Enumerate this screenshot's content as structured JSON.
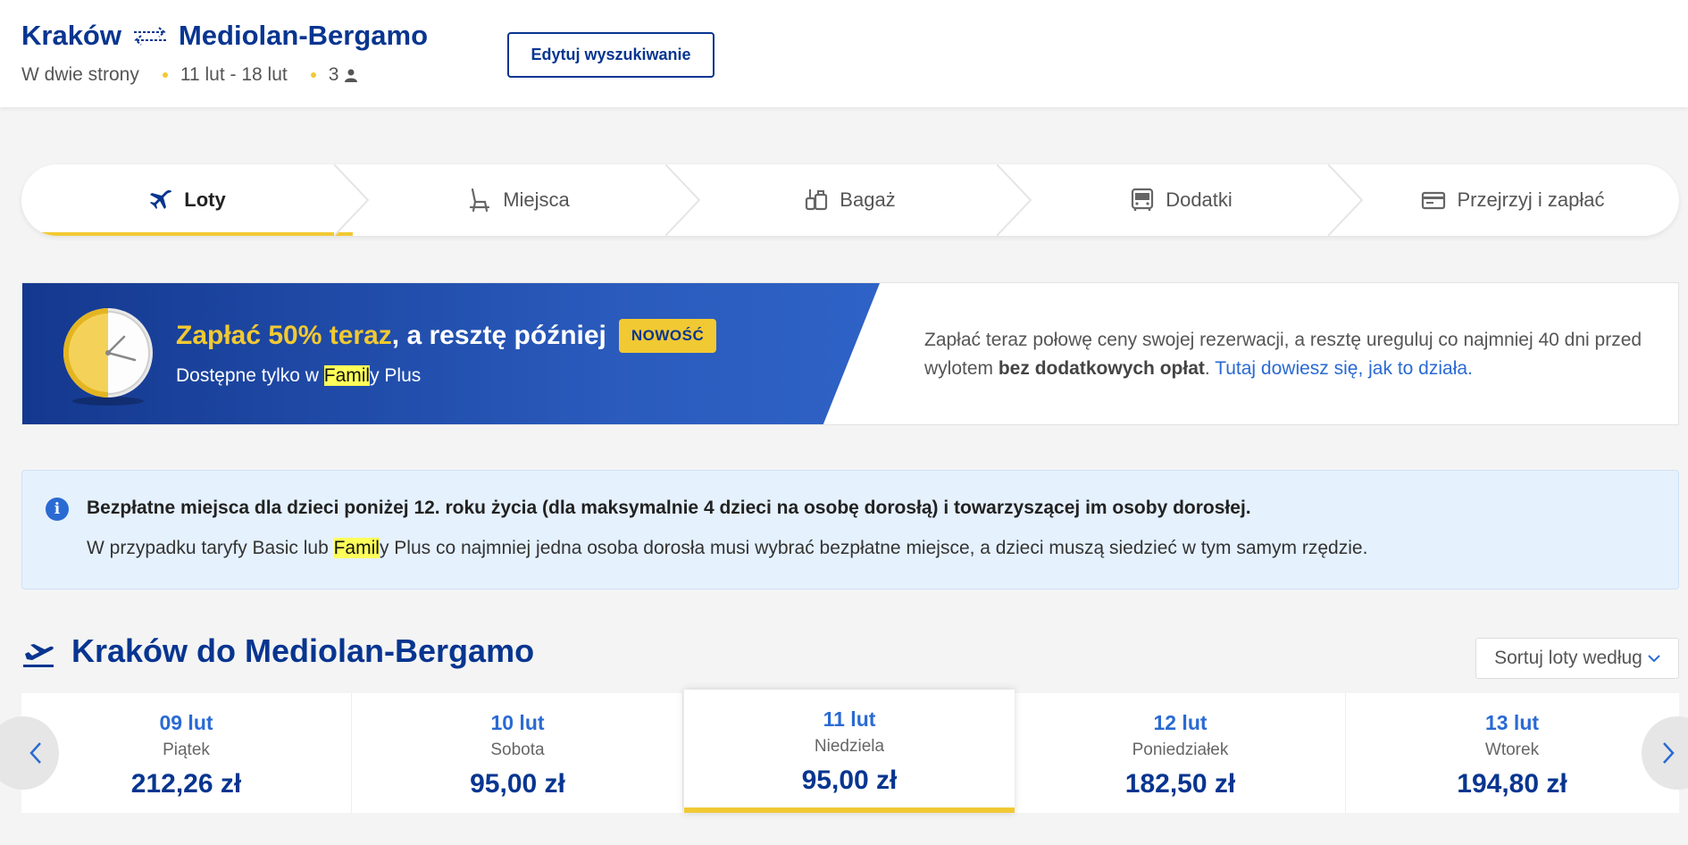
{
  "header": {
    "origin": "Kraków",
    "destination": "Mediolan-Bergamo",
    "trip_type": "W dwie strony",
    "dates": "11 lut - 18 lut",
    "passengers": "3",
    "edit_label": "Edytuj wyszukiwanie"
  },
  "steps": [
    {
      "label": "Loty",
      "icon": "plane-icon"
    },
    {
      "label": "Miejsca",
      "icon": "seat-icon"
    },
    {
      "label": "Bagaż",
      "icon": "luggage-icon"
    },
    {
      "label": "Dodatki",
      "icon": "bus-icon"
    },
    {
      "label": "Przejrzyj i zapłać",
      "icon": "card-icon"
    }
  ],
  "promo": {
    "title_highlight": "Zapłać 50% teraz",
    "title_rest": ", a resztę później",
    "badge": "NOWOŚĆ",
    "sub_before": "Dostępne tylko w ",
    "sub_mark": "Famil",
    "sub_after": "y Plus",
    "text_before": "Zapłać teraz połowę ceny swojej rezerwacji, a resztę ureguluj co najmniej 40 dni przed wylotem ",
    "text_bold": "bez dodatkowych opłat",
    "text_dot": ". ",
    "link": "Tutaj dowiesz się, jak to działa."
  },
  "info": {
    "icon_glyph": "i",
    "bold": "Bezpłatne miejsca dla dzieci poniżej 12. roku życia (dla maksymalnie 4 dzieci na osobę dorosłą) i towarzyszącej im osoby dorosłej.",
    "text_before": "W przypadku taryfy Basic lub ",
    "text_mark": "Famil",
    "text_after": "y Plus co najmniej jedna osoba dorosła musi wybrać bezpłatne miejsce, a dzieci muszą siedzieć w tym samym rzędzie."
  },
  "flights": {
    "title": "Kraków do Mediolan-Bergamo",
    "sort_label": "Sortuj loty według"
  },
  "dates": [
    {
      "date": "09 lut",
      "weekday": "Piątek",
      "price": "212,26 zł",
      "selected": false
    },
    {
      "date": "10 lut",
      "weekday": "Sobota",
      "price": "95,00 zł",
      "selected": false
    },
    {
      "date": "11 lut",
      "weekday": "Niedziela",
      "price": "95,00 zł",
      "selected": true
    },
    {
      "date": "12 lut",
      "weekday": "Poniedziałek",
      "price": "182,50 zł",
      "selected": false
    },
    {
      "date": "13 lut",
      "weekday": "Wtorek",
      "price": "194,80 zł",
      "selected": false
    }
  ],
  "colors": {
    "brand": "#073590",
    "accent": "#f1c933",
    "link": "#2a6ad3"
  }
}
